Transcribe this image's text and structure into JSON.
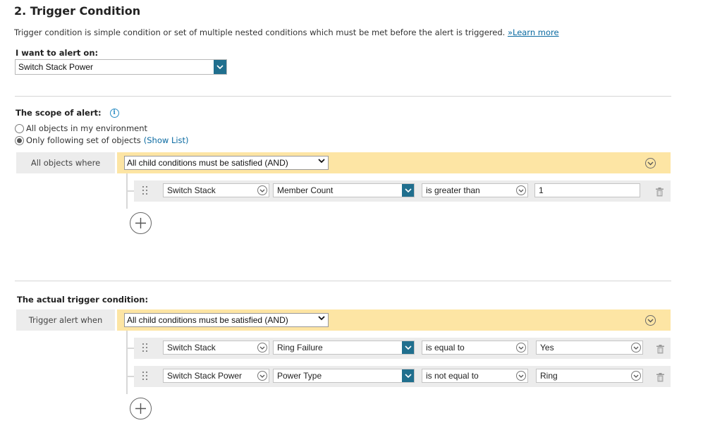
{
  "section_title": "2. Trigger Condition",
  "description": {
    "text": "Trigger condition is simple condition or set of multiple nested conditions which must be met before the alert is triggered.",
    "link_prefix": "»",
    "link_label": "Learn more"
  },
  "alert_on": {
    "label": "I want to alert on:",
    "selected": "Switch Stack Power"
  },
  "scope": {
    "label": "The scope of alert:",
    "options": [
      {
        "label": "All objects in my environment",
        "checked": false
      },
      {
        "label": "Only following set of objects",
        "checked": true
      }
    ],
    "show_list_label": "(Show List)",
    "group_label": "All objects where",
    "group_operator": "All child conditions must be satisfied (AND)",
    "conditions": [
      {
        "object": "Switch Stack",
        "field": "Member Count",
        "operator": "is greater than",
        "value": "1"
      }
    ]
  },
  "trigger": {
    "label": "The actual trigger condition:",
    "group_label": "Trigger alert when",
    "group_operator": "All child conditions must be satisfied (AND)",
    "conditions": [
      {
        "object": "Switch Stack",
        "field": "Ring Failure",
        "operator": "is equal to",
        "value": "Yes"
      },
      {
        "object": "Switch Stack Power",
        "field": "Power Type",
        "operator": "is not equal to",
        "value": "Ring"
      }
    ]
  },
  "colors": {
    "accent": "#206f8e",
    "link": "#0a6aa1",
    "group_bar": "#fde5a4",
    "row_bg": "#ececec"
  }
}
